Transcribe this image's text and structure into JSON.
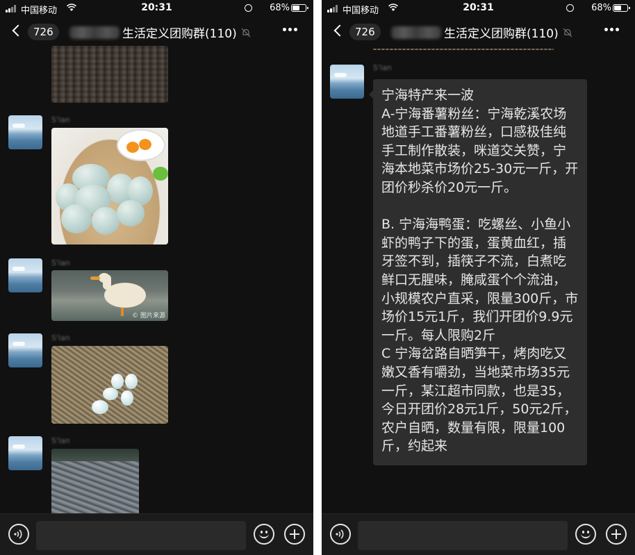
{
  "status_bar": {
    "carrier": "中国移动",
    "time": "20:31",
    "battery_percent": "68%"
  },
  "nav": {
    "unread_count": "726",
    "group_title": "生活定义团购群(110)"
  },
  "left_screen": {
    "messages": [
      {
        "type": "image",
        "subject": "dried-seafood-tiles"
      },
      {
        "sender": "S'lan",
        "type": "image",
        "subject": "sea-duck-eggs"
      },
      {
        "sender": "S'lan",
        "type": "image",
        "subject": "duck",
        "watermark": "© 图片来源"
      },
      {
        "sender": "S'lan",
        "type": "image",
        "subject": "eggs-in-nest"
      },
      {
        "sender": "S'lan",
        "type": "image",
        "subject": "sun-drying"
      }
    ]
  },
  "right_screen": {
    "message": {
      "sender": "S'lan",
      "text": "宁海特产来一波\nA-宁海番薯粉丝：宁海乾溪农场地道手工番薯粉丝，口感极佳纯手工制作散装，咪道交关赞，宁海本地菜市场价25-30元一斤，开团价秒杀价20元一斤。\n\nB. 宁海海鸭蛋：吃螺丝、小鱼小虾的鸭子下的蛋，蛋黄血红，插牙签不到，插筷子不流，白煮吃鲜口无腥味，腌咸蛋个个流油，小规模农户直采，限量300斤，市场价15元1斤，我们开团价9.9元一斤。每人限购2斤\nC 宁海岔路自晒笋干，烤肉吃又嫩又香有嚼劲，当地菜市场35元一斤，某江超市同款，也是35，今日开团价28元1斤，50元2斤，农户自晒，数量有限，限量100斤，约起来"
    }
  },
  "input": {
    "placeholder": ""
  },
  "icons": [
    "signal-icon",
    "wifi-icon",
    "orientation-lock-icon",
    "battery-icon",
    "back-chevron-icon",
    "mute-bell-icon",
    "more-dots-icon",
    "voice-icon",
    "emoji-icon",
    "plus-icon"
  ]
}
